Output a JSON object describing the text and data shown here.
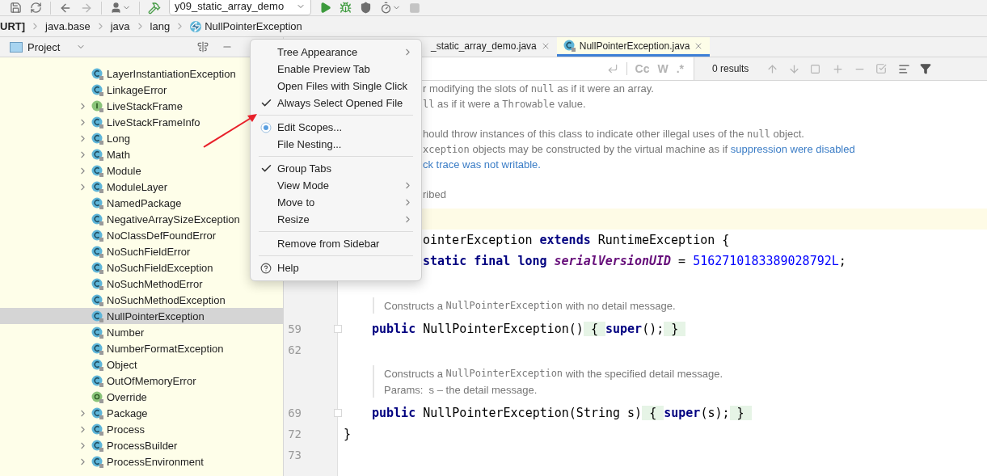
{
  "toolbar": {
    "run_config": "y09_static_array_demo"
  },
  "breadcrumbs": [
    {
      "label": "URT]",
      "kind": "root"
    },
    {
      "label": "java.base",
      "kind": "package"
    },
    {
      "label": "java",
      "kind": "package"
    },
    {
      "label": "lang",
      "kind": "package"
    },
    {
      "label": "NullPointerException",
      "kind": "exception"
    }
  ],
  "project_panel": {
    "title": "Project",
    "items": [
      {
        "name": "LayerInstantiationException",
        "kind": "class",
        "expandable": false,
        "selected": false
      },
      {
        "name": "LinkageError",
        "kind": "class",
        "expandable": false,
        "selected": false
      },
      {
        "name": "LiveStackFrame",
        "kind": "interface",
        "expandable": true,
        "selected": false
      },
      {
        "name": "LiveStackFrameInfo",
        "kind": "class",
        "expandable": true,
        "selected": false
      },
      {
        "name": "Long",
        "kind": "class",
        "expandable": true,
        "selected": false
      },
      {
        "name": "Math",
        "kind": "class",
        "expandable": true,
        "selected": false
      },
      {
        "name": "Module",
        "kind": "class",
        "expandable": true,
        "selected": false
      },
      {
        "name": "ModuleLayer",
        "kind": "class",
        "expandable": true,
        "selected": false
      },
      {
        "name": "NamedPackage",
        "kind": "class",
        "expandable": false,
        "selected": false
      },
      {
        "name": "NegativeArraySizeException",
        "kind": "class",
        "expandable": false,
        "selected": false
      },
      {
        "name": "NoClassDefFoundError",
        "kind": "class",
        "expandable": false,
        "selected": false
      },
      {
        "name": "NoSuchFieldError",
        "kind": "class",
        "expandable": false,
        "selected": false
      },
      {
        "name": "NoSuchFieldException",
        "kind": "class",
        "expandable": false,
        "selected": false
      },
      {
        "name": "NoSuchMethodError",
        "kind": "class",
        "expandable": false,
        "selected": false
      },
      {
        "name": "NoSuchMethodException",
        "kind": "class",
        "expandable": false,
        "selected": false
      },
      {
        "name": "NullPointerException",
        "kind": "class",
        "expandable": false,
        "selected": true
      },
      {
        "name": "Number",
        "kind": "class",
        "expandable": false,
        "selected": false
      },
      {
        "name": "NumberFormatException",
        "kind": "class",
        "expandable": false,
        "selected": false
      },
      {
        "name": "Object",
        "kind": "class",
        "expandable": false,
        "selected": false
      },
      {
        "name": "OutOfMemoryError",
        "kind": "class",
        "expandable": false,
        "selected": false
      },
      {
        "name": "Override",
        "kind": "annotation",
        "expandable": false,
        "selected": false
      },
      {
        "name": "Package",
        "kind": "class",
        "expandable": true,
        "selected": false
      },
      {
        "name": "Process",
        "kind": "class",
        "expandable": true,
        "selected": false
      },
      {
        "name": "ProcessBuilder",
        "kind": "class",
        "expandable": true,
        "selected": false
      },
      {
        "name": "ProcessEnvironment",
        "kind": "class",
        "expandable": true,
        "selected": false
      }
    ]
  },
  "editor": {
    "tabs": [
      {
        "label": "_static_array_demo.java",
        "selected": false
      },
      {
        "label": "NullPointerException.java",
        "selected": true
      }
    ],
    "find": {
      "toggles": [
        "Cc",
        "W",
        ".*"
      ],
      "results": "0 results"
    },
    "blocks": [
      {
        "kind": "doc_partial",
        "lines": [
          {
            "segments": [
              {
                "kind": "text",
                "text": "r modifying the slots of "
              },
              {
                "kind": "mono",
                "text": "null"
              },
              {
                "kind": "text",
                "text": " as if it were an array."
              }
            ]
          },
          {
            "segments": [
              {
                "kind": "mono",
                "text": "ll"
              },
              {
                "kind": "text",
                "text": " as if it were a "
              },
              {
                "kind": "mono",
                "text": "Throwable"
              },
              {
                "kind": "text",
                "text": " value."
              }
            ]
          }
        ]
      },
      {
        "kind": "doc_partial",
        "lines": [
          {
            "segments": [
              {
                "kind": "text",
                "text": "hould throw instances of this class to indicate other illegal uses of the "
              },
              {
                "kind": "mono",
                "text": "null"
              },
              {
                "kind": "text",
                "text": " object."
              }
            ]
          },
          {
            "segments": [
              {
                "kind": "mono",
                "text": "xception"
              },
              {
                "kind": "text",
                "text": " objects may be constructed by the virtual machine as if "
              },
              {
                "kind": "link",
                "text": "suppression were disabled"
              }
            ]
          },
          {
            "segments": [
              {
                "kind": "link",
                "text": "ck trace was not writable."
              }
            ]
          }
        ]
      },
      {
        "kind": "doc_partial",
        "lines": [
          {
            "segments": [
              {
                "kind": "text",
                "text": "ribed"
              }
            ]
          }
        ]
      },
      {
        "kind": "caret"
      },
      {
        "kind": "code_partial",
        "lines": [
          {
            "segments": [
              {
                "kind": "plain",
                "text": "ointerException "
              },
              {
                "kind": "kw",
                "text": "extends"
              },
              {
                "kind": "plain",
                "text": " RuntimeException {"
              }
            ]
          },
          {
            "segments": [
              {
                "kind": "kw",
                "text": "static final long"
              },
              {
                "kind": "field",
                "text": " serialVersionUID"
              },
              {
                "kind": "plain",
                "text": " = "
              },
              {
                "kind": "num",
                "text": "5162710183389028792L"
              },
              {
                "kind": "plain",
                "text": ";"
              }
            ]
          }
        ]
      },
      {
        "kind": "doc",
        "lines": [
          {
            "segments": [
              {
                "kind": "text",
                "text": "Constructs a "
              },
              {
                "kind": "mono",
                "text": "NullPointerException"
              },
              {
                "kind": "text",
                "text": " with no detail message."
              }
            ]
          }
        ]
      },
      {
        "kind": "member_code",
        "lines": [
          {
            "number": "59",
            "foldable": true,
            "segments": [
              {
                "kind": "kw",
                "text": "public"
              },
              {
                "kind": "plain",
                "text": " NullPointerException()"
              },
              {
                "kind": "brace",
                "text": " { "
              },
              {
                "kind": "kw",
                "text": "super"
              },
              {
                "kind": "plain",
                "text": "();"
              },
              {
                "kind": "brace",
                "text": " } "
              }
            ]
          },
          {
            "number": "62",
            "foldable": false
          }
        ]
      },
      {
        "kind": "doc",
        "lines": [
          {
            "segments": [
              {
                "kind": "text",
                "text": "Constructs a "
              },
              {
                "kind": "mono",
                "text": "NullPointerException"
              },
              {
                "kind": "text",
                "text": " with the specified detail message."
              }
            ]
          },
          {
            "segments": [
              {
                "kind": "text",
                "text": "Params:  s – the detail message."
              }
            ]
          }
        ]
      },
      {
        "kind": "member_code",
        "lines": [
          {
            "number": "69",
            "foldable": true,
            "segments": [
              {
                "kind": "kw",
                "text": "public"
              },
              {
                "kind": "plain",
                "text": " NullPointerException(String s)"
              },
              {
                "kind": "brace",
                "text": " { "
              },
              {
                "kind": "kw",
                "text": "super"
              },
              {
                "kind": "plain",
                "text": "(s);"
              },
              {
                "kind": "brace",
                "text": " } "
              }
            ]
          }
        ]
      },
      {
        "kind": "code",
        "lines": [
          {
            "number": "72",
            "foldable": false,
            "segments": [
              {
                "kind": "plain",
                "text": "}"
              }
            ]
          },
          {
            "number": "73",
            "foldable": false
          }
        ]
      }
    ]
  },
  "menu": {
    "items": [
      {
        "kind": "item",
        "label": "Tree Appearance",
        "checked": false,
        "submenu": true
      },
      {
        "kind": "item",
        "label": "Enable Preview Tab",
        "checked": false,
        "submenu": false
      },
      {
        "kind": "item",
        "label": "Open Files with Single Click",
        "checked": false,
        "submenu": false
      },
      {
        "kind": "item",
        "label": "Always Select Opened File",
        "checked": true,
        "submenu": false
      },
      {
        "kind": "separator"
      },
      {
        "kind": "scope_item",
        "label": "Edit Scopes...",
        "submenu": false
      },
      {
        "kind": "item",
        "label": "File Nesting...",
        "checked": false,
        "submenu": false
      },
      {
        "kind": "separator"
      },
      {
        "kind": "item",
        "label": "Group Tabs",
        "checked": true,
        "submenu": false
      },
      {
        "kind": "item",
        "label": "View Mode",
        "checked": false,
        "submenu": true
      },
      {
        "kind": "item",
        "label": "Move to",
        "checked": false,
        "submenu": true
      },
      {
        "kind": "item",
        "label": "Resize",
        "checked": false,
        "submenu": true
      },
      {
        "kind": "separator"
      },
      {
        "kind": "item",
        "label": "Remove from Sidebar",
        "checked": false,
        "submenu": false
      },
      {
        "kind": "separator"
      },
      {
        "kind": "help_item",
        "label": "Help",
        "submenu": false
      }
    ]
  }
}
